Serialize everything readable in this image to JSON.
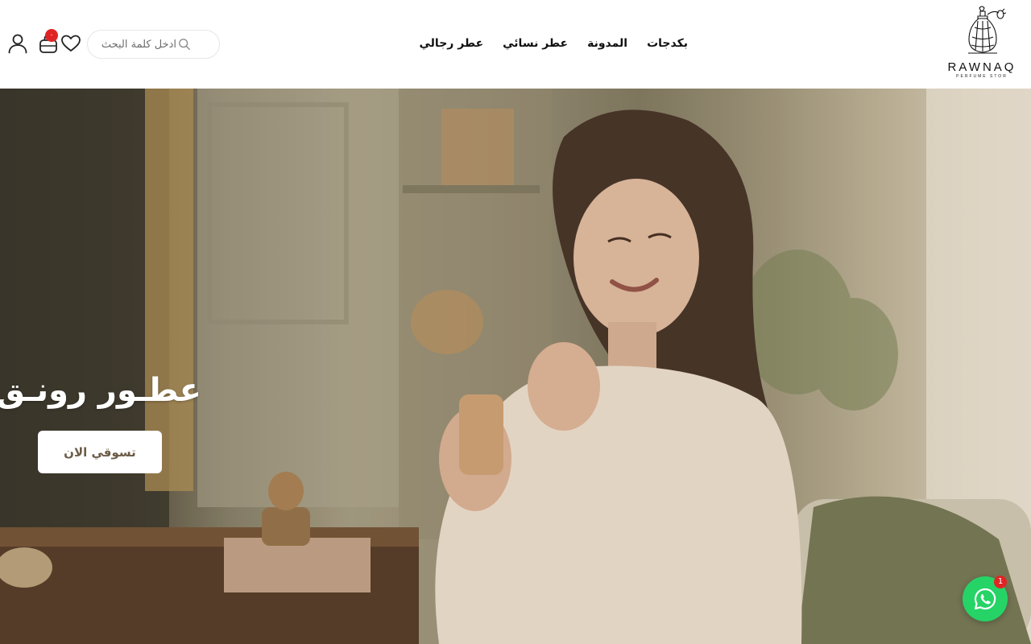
{
  "brand": {
    "name": "RAWNAQ",
    "tagline": "PERFUME STOR"
  },
  "nav": {
    "items": [
      {
        "label": "عطر رجالي"
      },
      {
        "label": "عطر نسائي"
      },
      {
        "label": "المدونة"
      },
      {
        "label": "بكدجات"
      }
    ]
  },
  "search": {
    "placeholder": "ادخل كلمة البحث",
    "icon": "search-icon"
  },
  "header_icons": {
    "wishlist": "heart-icon",
    "cart": "shopping-bag-icon",
    "cart_count": "٠",
    "account": "user-icon"
  },
  "hero": {
    "title": "عطـور رونـق",
    "cta_label": "تسوقي الان"
  },
  "whatsapp": {
    "icon": "whatsapp-icon",
    "badge": "1"
  },
  "colors": {
    "cart_badge": "#e02424",
    "whatsapp": "#25d366",
    "cta_text": "#6b5b47"
  }
}
